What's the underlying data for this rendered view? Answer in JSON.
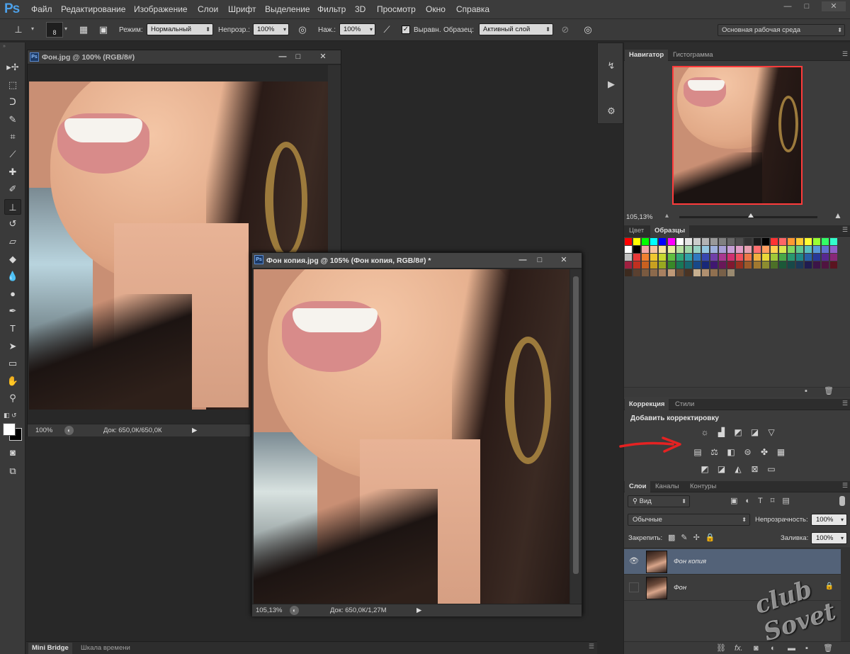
{
  "app": {
    "logo": "Ps"
  },
  "menubar": {
    "items": [
      "Файл",
      "Редактирование",
      "Изображение",
      "Слои",
      "Шрифт",
      "Выделение",
      "Фильтр",
      "3D",
      "Просмотр",
      "Окно",
      "Справка"
    ],
    "window_controls": [
      "—",
      "□",
      "✕"
    ]
  },
  "options": {
    "brush_size": "8",
    "mode_label": "Режим:",
    "mode_value": "Нормальный",
    "opacity_label": "Непрозр.:",
    "opacity_value": "100%",
    "flow_label": "Наж.:",
    "flow_value": "100%",
    "aligned_label": "Выравн.",
    "aligned_checked": true,
    "sample_label": "Образец:",
    "sample_value": "Активный слой",
    "workspace": "Основная рабочая среда"
  },
  "tools": [
    {
      "name": "move-tool-icon",
      "glyph": "▸✢"
    },
    {
      "name": "marquee-tool-icon",
      "glyph": "⬚"
    },
    {
      "name": "lasso-tool-icon",
      "glyph": "ᑐ"
    },
    {
      "name": "quick-selection-tool-icon",
      "glyph": "✎"
    },
    {
      "name": "crop-tool-icon",
      "glyph": "⌗"
    },
    {
      "name": "eyedropper-tool-icon",
      "glyph": "⟋"
    },
    {
      "name": "healing-brush-tool-icon",
      "glyph": "✚"
    },
    {
      "name": "brush-tool-icon",
      "glyph": "✐"
    },
    {
      "name": "clone-stamp-tool-icon",
      "glyph": "⊥"
    },
    {
      "name": "history-brush-tool-icon",
      "glyph": "↺"
    },
    {
      "name": "eraser-tool-icon",
      "glyph": "▱"
    },
    {
      "name": "paint-bucket-tool-icon",
      "glyph": "◆"
    },
    {
      "name": "blur-tool-icon",
      "glyph": "💧"
    },
    {
      "name": "dodge-tool-icon",
      "glyph": "●"
    },
    {
      "name": "pen-tool-icon",
      "glyph": "✒"
    },
    {
      "name": "type-tool-icon",
      "glyph": "T"
    },
    {
      "name": "path-selection-tool-icon",
      "glyph": "➤"
    },
    {
      "name": "rectangle-tool-icon",
      "glyph": "▭"
    },
    {
      "name": "hand-tool-icon",
      "glyph": "✋"
    },
    {
      "name": "zoom-tool-icon",
      "glyph": "⚲"
    }
  ],
  "doc1": {
    "title": "Фон.jpg @ 100% (RGB/8#)",
    "zoom": "100%",
    "doc_info": "Док: 650,0К/650,0К"
  },
  "doc2": {
    "title": "Фон копия.jpg @ 105% (Фон копия, RGB/8#) *",
    "zoom": "105,13%",
    "doc_info": "Док: 650,0К/1,27М"
  },
  "navigator": {
    "tabs": [
      "Навигатор",
      "Гистограмма"
    ],
    "zoom": "105,13%",
    "zoom_slider_fraction": 0.52
  },
  "swatches": {
    "tabs": [
      "Цвет",
      "Образцы"
    ],
    "colors": [
      "#ff0000",
      "#ffff00",
      "#00ff00",
      "#00ffff",
      "#0000ff",
      "#ff00ff",
      "#ffffff",
      "#e6e6e6",
      "#cccccc",
      "#b3b3b3",
      "#999999",
      "#808080",
      "#666666",
      "#4d4d4d",
      "#333333",
      "#1a1a1a",
      "#000000",
      "#ff3333",
      "#ff6666",
      "#ff9933",
      "#ffcc33",
      "#ffff33",
      "#99ff33",
      "#33ff66",
      "#33ffcc",
      "#ffffff",
      "#000000",
      "#f2a6a6",
      "#f7c3a0",
      "#f9e59c",
      "#e6f09e",
      "#b8e0a0",
      "#9fd6a8",
      "#97d1c4",
      "#93c6e0",
      "#9db0dc",
      "#a89fd6",
      "#c79fd6",
      "#e09fc8",
      "#e8a0b0",
      "#ff7070",
      "#ff9f60",
      "#ffd050",
      "#d8e850",
      "#80d860",
      "#60c890",
      "#58c0c0",
      "#5898d8",
      "#6070d0",
      "#9060c8",
      "#c0c0c0",
      "#e83838",
      "#f08030",
      "#f0c830",
      "#c8d830",
      "#60c040",
      "#30a878",
      "#30a0a8",
      "#3078c0",
      "#3848b0",
      "#7040a8",
      "#a83890",
      "#d03070",
      "#f05060",
      "#f07848",
      "#f0b040",
      "#e8d838",
      "#a0c838",
      "#48a848",
      "#289870",
      "#208888",
      "#2860a8",
      "#283898",
      "#582890",
      "#882878",
      "#a02040",
      "#c03020",
      "#c86020",
      "#c8a020",
      "#98a820",
      "#388828",
      "#187858",
      "#186870",
      "#184888",
      "#182878",
      "#401870",
      "#681858",
      "#801830",
      "#983020",
      "#9c5a2a",
      "#a07830",
      "#8c8c30",
      "#4c7028",
      "#1c5838",
      "#184848",
      "#1c3858",
      "#201c50",
      "#3c1448",
      "#501440",
      "#5a1420",
      "#3c2a1e",
      "#5a4030",
      "#7a5a40",
      "#8c6a4c",
      "#a88060",
      "#c09a78",
      "#6a4c34",
      "#4a3424",
      "#c8b090",
      "#b09070",
      "#907050",
      "#786048",
      "#9a8a70"
    ]
  },
  "adjustments": {
    "tabs": [
      "Коррекция",
      "Стили"
    ],
    "heading": "Добавить корректировку",
    "row1": [
      "brightness-contrast-icon",
      "levels-icon",
      "curves-icon",
      "exposure-icon",
      "vibrance-icon"
    ],
    "row2": [
      "hue-saturation-icon",
      "color-balance-icon",
      "black-white-icon",
      "photo-filter-icon",
      "channel-mixer-icon",
      "color-lookup-icon"
    ],
    "row3": [
      "invert-icon",
      "posterize-icon",
      "threshold-icon",
      "selective-color-icon",
      "gradient-map-icon"
    ]
  },
  "layers": {
    "tabs": [
      "Слои",
      "Каналы",
      "Контуры"
    ],
    "filter_kind": "Вид",
    "blend_mode": "Обычные",
    "opacity_label": "Непрозрачность:",
    "opacity_value": "100%",
    "lock_label": "Закрепить:",
    "fill_label": "Заливка:",
    "fill_value": "100%",
    "items": [
      {
        "name": "Фон копия",
        "visible": true,
        "selected": true
      },
      {
        "name": "Фон",
        "visible": false,
        "selected": false,
        "locked": true
      }
    ]
  },
  "bottom_tabs": [
    "Mini Bridge",
    "Шкала времени"
  ],
  "watermark": "club Sovet",
  "accent": {
    "annotation_arrow": "#e52222",
    "selection_row": "#536278",
    "nav_frame": "#ff3b3b"
  }
}
